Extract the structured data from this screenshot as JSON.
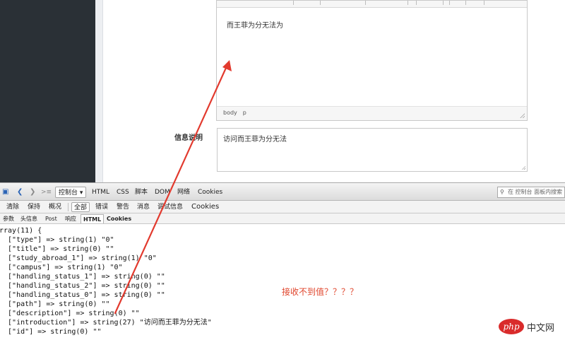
{
  "editor": {
    "content": "而王菲为分无法为",
    "status_path": [
      "body",
      "p"
    ]
  },
  "info_field": {
    "label": "信息说明",
    "value": "访问而王菲为分无法"
  },
  "firebug": {
    "main_tabs": [
      "控制台",
      "HTML",
      "CSS",
      "脚本",
      "DOM",
      "网络",
      "Cookies"
    ],
    "active_tab": "控制台",
    "search_placeholder": "在 控制台 面板内搜索",
    "console_buttons": [
      "清除",
      "保持",
      "概况",
      "全部",
      "错误",
      "警告",
      "消息",
      "调试信息",
      "Cookies"
    ],
    "pressed_button": "全部",
    "request_tabs": [
      "参数",
      "头信息",
      "Post",
      "响应",
      "HTML",
      "Cookies"
    ],
    "active_request_tab": "HTML",
    "dump_lines": [
      "rray(11) {",
      "  [\"type\"] => string(1) \"0\"",
      "  [\"title\"] => string(0) \"\"",
      "  [\"study_abroad_1\"] => string(1) \"0\"",
      "  [\"campus\"] => string(1) \"0\"",
      "  [\"handling_status_1\"] => string(0) \"\"",
      "  [\"handling_status_2\"] => string(0) \"\"",
      "  [\"handling_status_0\"] => string(0) \"\"",
      "  [\"path\"] => string(0) \"\"",
      "  [\"description\"] => string(0) \"\"",
      "  [\"introduction\"] => string(27) \"访问而王菲为分无法\"",
      "  [\"id\"] => string(0) \"\""
    ]
  },
  "annotation": "接收不到值？？？？",
  "watermark": {
    "logo": "php",
    "site": "中文网"
  },
  "colors": {
    "sidebar": "#2a3036",
    "annotation": "#e0452c",
    "arrow": "#e23a2e"
  }
}
